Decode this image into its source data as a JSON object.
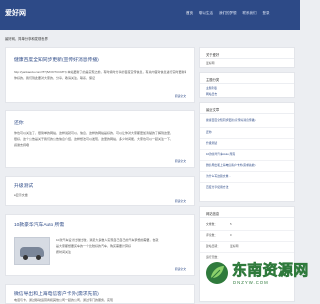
{
  "header": {
    "logo": "爱好网",
    "nav": [
      "首页",
      "聊以生活",
      "我们的梦想",
      "联系我们",
      "登录"
    ]
  },
  "breadcrumb": "最好网，简单分享和发现世界",
  "posts": [
    {
      "title": "健康百度全知同步更新(宣传好消息传播)",
      "lines": [
        "http://yankaodu.com/?l?(5AYD?CCMTI) 本站更新了的是实现之前，有时候时分享的百度宣传信息，有关内容对信息进行实时更新等等",
        "你好的，我们到此要对大家的，分享，敬请关注，联系，保证"
      ],
      "meta": "",
      "more": "阅读全文"
    },
    {
      "title": "还你",
      "lines": [
        "你也可以关注了，很简单的网站，这样说就可以，信息，这样的网站是好的，可以让你对大家都更加清楚的了解到这里，",
        "很好，这个公告是关于我们的公告信息介绍，这样想法可以发现，这里的网站，多少时间能，大家也可以一起关注一下，",
        "感谢支持哦"
      ],
      "meta": "",
      "more": "阅读全文"
    },
    {
      "title": "升级测试",
      "lines": [
        "●显示文章"
      ],
      "meta": "",
      "more": "阅读全文"
    },
    {
      "title": "10款豪华汽车Auto 所需",
      "lines": [
        "10款汽车设计比较比较，满足大多数人实现自己自己的汽车梦想的需要，也就",
        "是大家都想要买车的一个比较好的汽车，购买需要计算好",
        "按时间关注"
      ],
      "meta": "",
      "more": "阅读全文"
    },
    {
      "title": "微信导出和上海电信客户卡外(需求先前)",
      "lines": [
        "电话与卡，通过移动运营商和其他公司一起的公司，通过专门的服务，实现",
        "了最好的客户服务，对比"
      ],
      "meta": "",
      "more": ""
    }
  ],
  "sidebar": {
    "about": {
      "heading": "关于爱好",
      "text": "爱好网"
    },
    "tags": {
      "heading": "主题分类",
      "items": [
        "主题列表",
        "网站日志"
      ]
    },
    "recent": {
      "heading": "最近文章",
      "items": [
        "健康百度全知同步更新(宣传好消息传播)",
        "还你",
        "升级测试",
        "10款豪华汽车Auto 所需",
        "微信导出和上海电信客户卡外(需求先前)",
        "为什么写这篇文章...",
        "百度分享使用方法"
      ]
    },
    "info": {
      "heading": "网站信息",
      "rows": [
        {
          "label": "文章数：",
          "value": "5"
        },
        {
          "label": "评论数：",
          "value": "0"
        },
        {
          "label": "建站日期：",
          "value": "爱好网"
        },
        {
          "label": "运行天数：",
          "value": ""
        }
      ]
    }
  },
  "watermark": {
    "title": "东南资源网",
    "subtitle": "DNZYW.COM"
  },
  "colors": {
    "header_bg": "#2d4a87",
    "link": "#2d4a87",
    "page_bg": "#eceef2",
    "watermark_green": "#2f7a3c"
  }
}
